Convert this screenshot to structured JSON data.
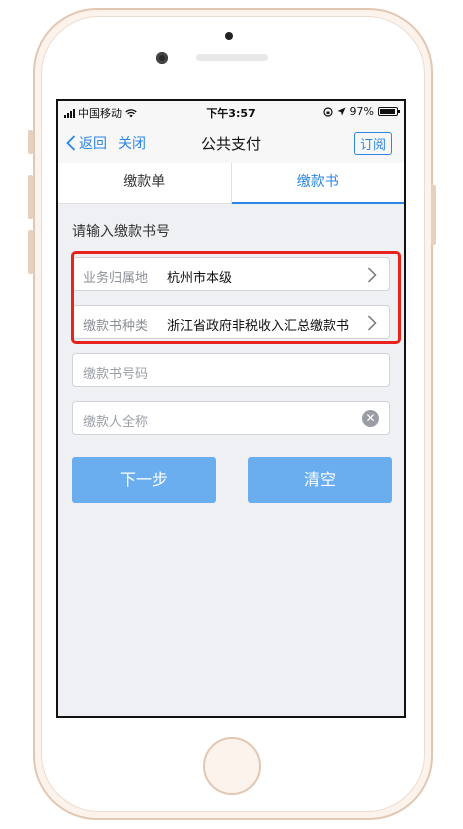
{
  "status": {
    "carrier": "中国移动",
    "time": "下午3:57",
    "battery": "97%"
  },
  "nav": {
    "back_label": "返回",
    "close_label": "关闭",
    "title": "公共支付",
    "subscribe_label": "订阅"
  },
  "tabs": [
    {
      "label": "缴款单",
      "active": false
    },
    {
      "label": "缴款书",
      "active": true
    }
  ],
  "form": {
    "section_label": "请输入缴款书号",
    "region": {
      "label": "业务归属地",
      "value": "杭州市本级"
    },
    "doc_type": {
      "label": "缴款书种类",
      "value": "浙江省政府非税收入汇总缴款书"
    },
    "doc_number": {
      "placeholder": "缴款书号码"
    },
    "payer_name": {
      "placeholder": "缴款人全称"
    }
  },
  "buttons": {
    "next_label": "下一步",
    "clear_label": "清空"
  },
  "colors": {
    "accent": "#2b86e6",
    "button": "#6aaef0",
    "highlight": "#e8231e"
  }
}
